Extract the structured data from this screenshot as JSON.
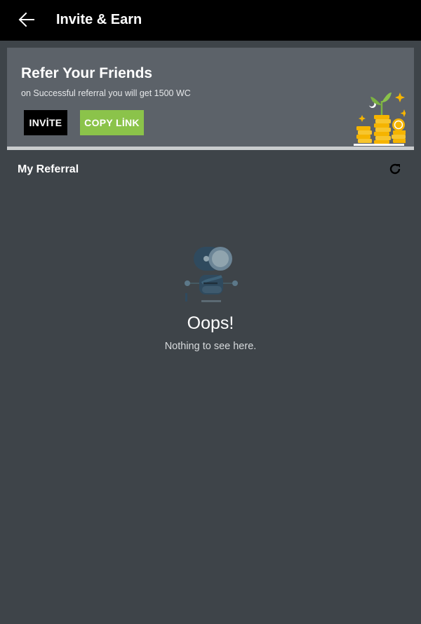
{
  "header": {
    "title": "Invite & Earn",
    "back_icon": "arrow-left-icon"
  },
  "refer_card": {
    "title": "Refer Your Friends",
    "subtitle": "on Successful referral you will get 1500 WC",
    "invite_label": "INVİTE",
    "copy_link_label": "COPY LİNK",
    "illustration_icon": "coin-stack-plant-icon"
  },
  "referral_section": {
    "title": "My Referral",
    "refresh_icon": "refresh-icon"
  },
  "empty_state": {
    "title": "Oops!",
    "message": "Nothing to see here.",
    "illustration_icon": "robot-icon"
  },
  "colors": {
    "topbar": "#000000",
    "background": "#3e4449",
    "card": "#5c6269",
    "invite_button": "#000000",
    "copy_button": "#8bc34a",
    "coin": "#f5b400",
    "leaf": "#7cb342"
  }
}
